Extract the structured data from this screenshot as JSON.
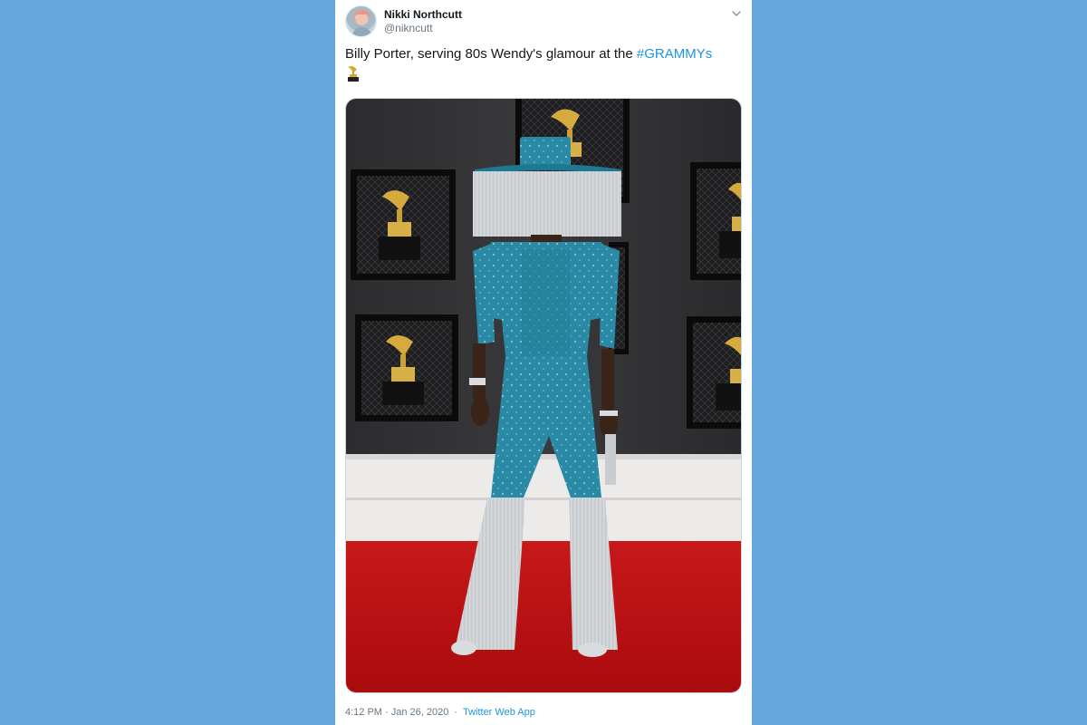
{
  "colors": {
    "page_background": "#64a8de",
    "card_background": "#ffffff",
    "text_primary": "#14171a",
    "text_secondary": "#657786",
    "link": "#1b95e0",
    "carpet_red": "#b90e10",
    "outfit_teal": "#2a8aa6"
  },
  "tweet": {
    "author": {
      "name": "Nikki Northcutt",
      "handle": "@nikncutt",
      "avatar_icon": "avatar-illustration"
    },
    "menu_icon": "chevron-down-icon",
    "text_before_hashtag": "Billy Porter, serving 80s Wendy's glamour at the ",
    "hashtag": "#GRAMMYs",
    "emoji_icon": "gramophone-trophy-icon",
    "timestamp": "4:12 PM · Jan 26, 2020",
    "separator": "·",
    "source": "Twitter Web App"
  }
}
